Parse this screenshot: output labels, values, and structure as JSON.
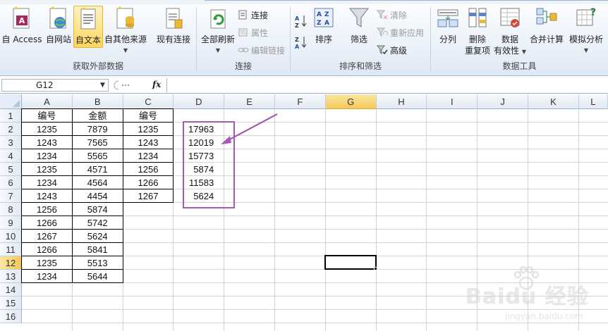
{
  "ribbon": {
    "groups": {
      "external_data": {
        "label": "获取外部数据",
        "buttons": {
          "access": "自 Access",
          "web": "自网站",
          "text": "自文本",
          "other": "自其他来源",
          "existing": "现有连接"
        }
      },
      "connections": {
        "label": "连接",
        "refresh_all": "全部刷新",
        "connections": "连接",
        "properties": "属性",
        "edit_links": "编辑链接"
      },
      "sort_filter": {
        "label": "排序和筛选",
        "sort": "排序",
        "filter": "筛选",
        "clear": "清除",
        "reapply": "重新应用",
        "advanced": "高级"
      },
      "data_tools": {
        "label": "数据工具",
        "text_to_columns": "分列",
        "remove_duplicates_1": "删除",
        "remove_duplicates_2": "重复项",
        "validation_1": "数据",
        "validation_2": "有效性",
        "consolidate": "合并计算",
        "what_if": "模拟分析"
      }
    }
  },
  "formula_bar": {
    "name_box": "G12",
    "fx": "fx",
    "formula": ""
  },
  "grid": {
    "columns": [
      "A",
      "B",
      "C",
      "D",
      "E",
      "F",
      "G",
      "H",
      "I",
      "J",
      "K",
      "L"
    ],
    "rows": [
      "1",
      "2",
      "3",
      "4",
      "5",
      "6",
      "7",
      "8",
      "9",
      "10",
      "11",
      "12",
      "13",
      "14",
      "15",
      "16"
    ],
    "active_column": "G",
    "active_row": "12",
    "col_A": [
      "编号",
      "1235",
      "1243",
      "1234",
      "1235",
      "1234",
      "1243",
      "1256",
      "1266",
      "1267",
      "1266",
      "1235",
      "1234"
    ],
    "col_B": [
      "金额",
      "7879",
      "7565",
      "5565",
      "4571",
      "4564",
      "4454",
      "5874",
      "5742",
      "5624",
      "5841",
      "5513",
      "5644"
    ],
    "col_C": [
      "编号",
      "1235",
      "1243",
      "1234",
      "1256",
      "1266",
      "1267"
    ],
    "col_D": [
      "17963",
      "12019",
      "15773",
      "5874",
      "11583",
      "5624"
    ]
  },
  "colors": {
    "highlight": "#a45bb5",
    "active_header": "#f6c858",
    "ribbon_border": "#9db2cc"
  },
  "watermark": {
    "brand": "Baidu 经验",
    "url": "jingyan.baidu.com"
  }
}
